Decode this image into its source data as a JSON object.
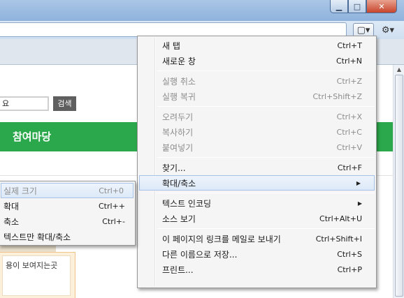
{
  "window": {
    "minimize_glyph": "▁",
    "maximize_glyph": "□",
    "close_glyph": "✕"
  },
  "toolbar": {
    "page_icon": "▢▾",
    "settings_icon": "⚙▾"
  },
  "page": {
    "search_value": "요",
    "search_button": "검색",
    "nav_label": "참여마당",
    "promo_text": "용이 보여지는곳"
  },
  "main_menu": [
    {
      "label": "새 탭",
      "shortcut": "Ctrl+T",
      "enabled": true
    },
    {
      "label": "새로운 창",
      "shortcut": "Ctrl+N",
      "enabled": true
    },
    {
      "label": "실행 취소",
      "shortcut": "Ctrl+Z",
      "enabled": false
    },
    {
      "label": "실행 복귀",
      "shortcut": "Ctrl+Shift+Z",
      "enabled": false
    },
    {
      "label": "오려두기",
      "shortcut": "Ctrl+X",
      "enabled": false
    },
    {
      "label": "복사하기",
      "shortcut": "Ctrl+C",
      "enabled": false
    },
    {
      "label": "붙여넣기",
      "shortcut": "Ctrl+V",
      "enabled": false
    },
    {
      "label": "찾기...",
      "shortcut": "Ctrl+F",
      "enabled": true
    },
    {
      "label": "확대/축소",
      "shortcut": "",
      "enabled": true,
      "submenu": true
    },
    {
      "label": "텍스트 인코딩",
      "shortcut": "",
      "enabled": true,
      "submenu": true
    },
    {
      "label": "소스 보기",
      "shortcut": "Ctrl+Alt+U",
      "enabled": true
    },
    {
      "label": "이 페이지의 링크를 메일로 보내기",
      "shortcut": "Ctrl+Shift+I",
      "enabled": true
    },
    {
      "label": "다른 이름으로 저장...",
      "shortcut": "Ctrl+S",
      "enabled": true
    },
    {
      "label": "프린트...",
      "shortcut": "Ctrl+P",
      "enabled": true
    }
  ],
  "sub_menu": [
    {
      "label": "실제 크기",
      "shortcut": "Ctrl+0"
    },
    {
      "label": "확대",
      "shortcut": "Ctrl++"
    },
    {
      "label": "축소",
      "shortcut": "Ctrl+-"
    },
    {
      "label": "텍스트만 확대/축소",
      "shortcut": ""
    }
  ],
  "submenu_arrow": "▶"
}
